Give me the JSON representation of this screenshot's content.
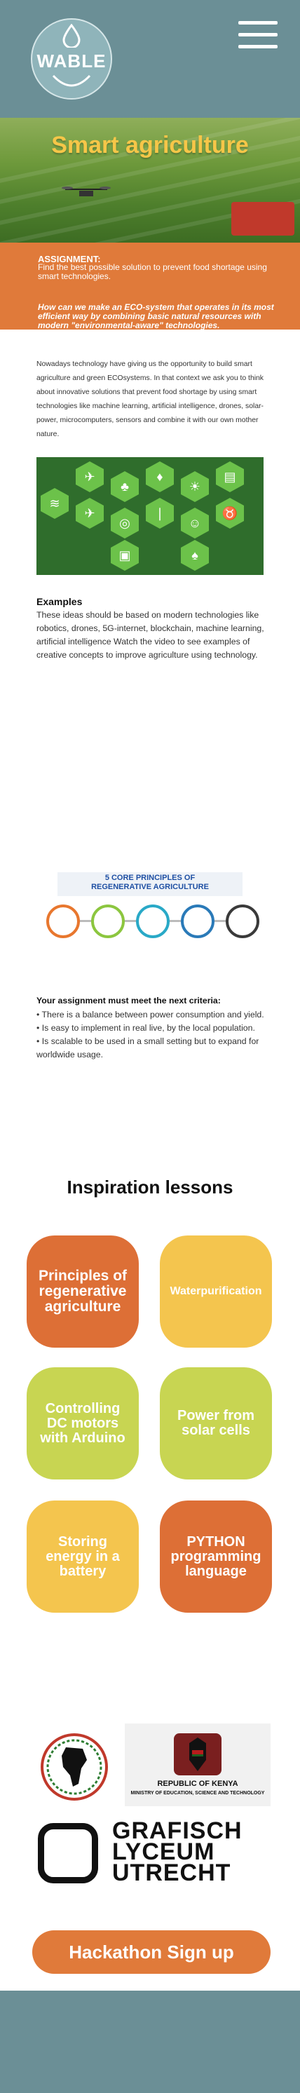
{
  "header": {
    "logo_text": "WABLE",
    "menu_icon": "hamburger-menu-icon"
  },
  "hero": {
    "title": "Smart agriculture"
  },
  "assignment": {
    "label": "ASSIGNMENT:",
    "text": "Find the best possible solution to prevent food shortage using smart technologies.",
    "question": "How can we make an ECO-system that operates in its most efficient way by combining basic natural resources with modern \"environmental-aware\" technologies."
  },
  "intro": {
    "text": "Nowadays technology have giving us the opportunity to build smart agriculture and green ECOsystems. In that context we ask you to think about innovative solutions that prevent food shortage by using smart technologies like machine learning, artificial intelligence, drones, solar-power, microcomputers, sensors and combine it with our own mother nature."
  },
  "examples": {
    "title": "Examples",
    "text": "These ideas should be based on modern technologies like robotics, drones, 5G-internet, blockchain, machine learning, artificial intelligence Watch the video to see examples of creative concepts to improve agriculture using technology."
  },
  "principles_image": {
    "title_line1": "5 CORE PRINCIPLES OF",
    "title_line2": "REGENERATIVE AGRICULTURE",
    "colors": [
      "#e8772e",
      "#8cc63f",
      "#29a9c7",
      "#2a7ab8",
      "#3a3a3a"
    ]
  },
  "criteria": {
    "title": "Your assignment must meet the next criteria:",
    "items": [
      "• There is a balance between power consumption and yield.",
      "• Is easy to implement in real live, by the local population.",
      "• Is scalable to be used in a small setting but to expand for worldwide usage."
    ]
  },
  "lessons": {
    "title": "Inspiration lessons",
    "cards": [
      {
        "label": "Principles of regenerative agriculture",
        "color": "#dd6f36"
      },
      {
        "label": "Waterpurification",
        "color": "#f4c54e"
      },
      {
        "label": "Controlling DC motors with Arduino",
        "color": "#c8d552"
      },
      {
        "label": "Power from solar cells",
        "color": "#c8d552"
      },
      {
        "label": "Storing energy in a battery",
        "color": "#f4c54e"
      },
      {
        "label": "PYTHON programming language",
        "color": "#dd6f36"
      }
    ]
  },
  "partners": {
    "kenya_line1": "REPUBLIC OF KENYA",
    "kenya_line2": "MINISTRY OF EDUCATION, SCIENCE AND TECHNOLOGY",
    "grafisch_line1": "GRAFISCH",
    "grafisch_line2": "LYCEUM",
    "grafisch_line3": "UTRECHT"
  },
  "signup": {
    "label": "Hackathon Sign up"
  },
  "colors": {
    "header": "#6b8f96",
    "accent_orange": "#e07a3a",
    "hero_title": "#f6c648"
  }
}
